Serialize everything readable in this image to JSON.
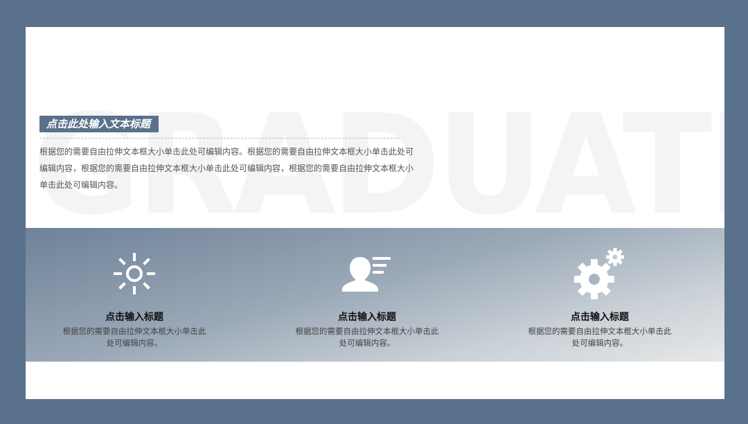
{
  "background_word": "GRADUATION",
  "section": {
    "title": "点击此处输入文本标题",
    "body": "根据您的需要自由拉伸文本框大小单击此处可编辑内容。根据您的需要自由拉伸文本框大小单击此处可编辑内容，根据您的需要自由拉伸文本框大小单击此处可编辑内容，根据您的需要自由拉伸文本框大小单击此处可编辑内容。"
  },
  "features": [
    {
      "icon": "sun-icon",
      "title": "点击输入标题",
      "desc": "根据您的需要自由拉伸文本框大小单击此处可编辑内容。"
    },
    {
      "icon": "user-list-icon",
      "title": "点击输入标题",
      "desc": "根据您的需要自由拉伸文本框大小单击此处可编辑内容。"
    },
    {
      "icon": "gears-icon",
      "title": "点击输入标题",
      "desc": "根据您的需要自由拉伸文本框大小单击此处可编辑内容。"
    }
  ],
  "colors": {
    "frame": "#5a718c",
    "accent": "#5a718c",
    "text": "#555555"
  }
}
